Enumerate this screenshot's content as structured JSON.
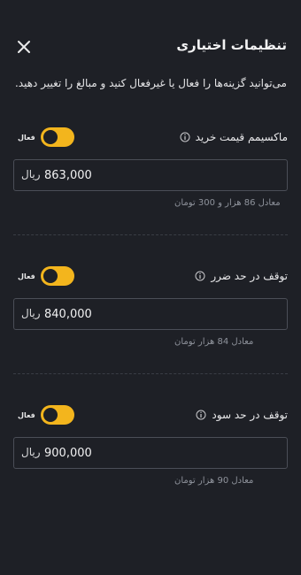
{
  "header": {
    "title": "تنظیمات اختیاری",
    "close_icon": "close-icon"
  },
  "description": "می‌توانید گزینه‌ها را فعال یا غیرفعال کنید و مبالغ را تغییر دهید.",
  "sections": [
    {
      "label": "ماکسیمم قیمت خرید",
      "toggle_label": "فعال",
      "toggle_on": true,
      "value": "863,000",
      "unit": "ریال",
      "hint": "معادل 86 هزار و 300 تومان"
    },
    {
      "label": "توقف در حد ضرر",
      "toggle_label": "فعال",
      "toggle_on": true,
      "value": "840,000",
      "unit": "ریال",
      "hint": "معادل 84 هزار تومان"
    },
    {
      "label": "توقف در حد سود",
      "toggle_label": "فعال",
      "toggle_on": true,
      "value": "900,000",
      "unit": "ریال",
      "hint": "معادل 90 هزار تومان"
    }
  ],
  "colors": {
    "background": "#1e2026",
    "accent": "#f3b51d",
    "field_border": "#4b4e57",
    "hint_text": "#8f939c"
  }
}
